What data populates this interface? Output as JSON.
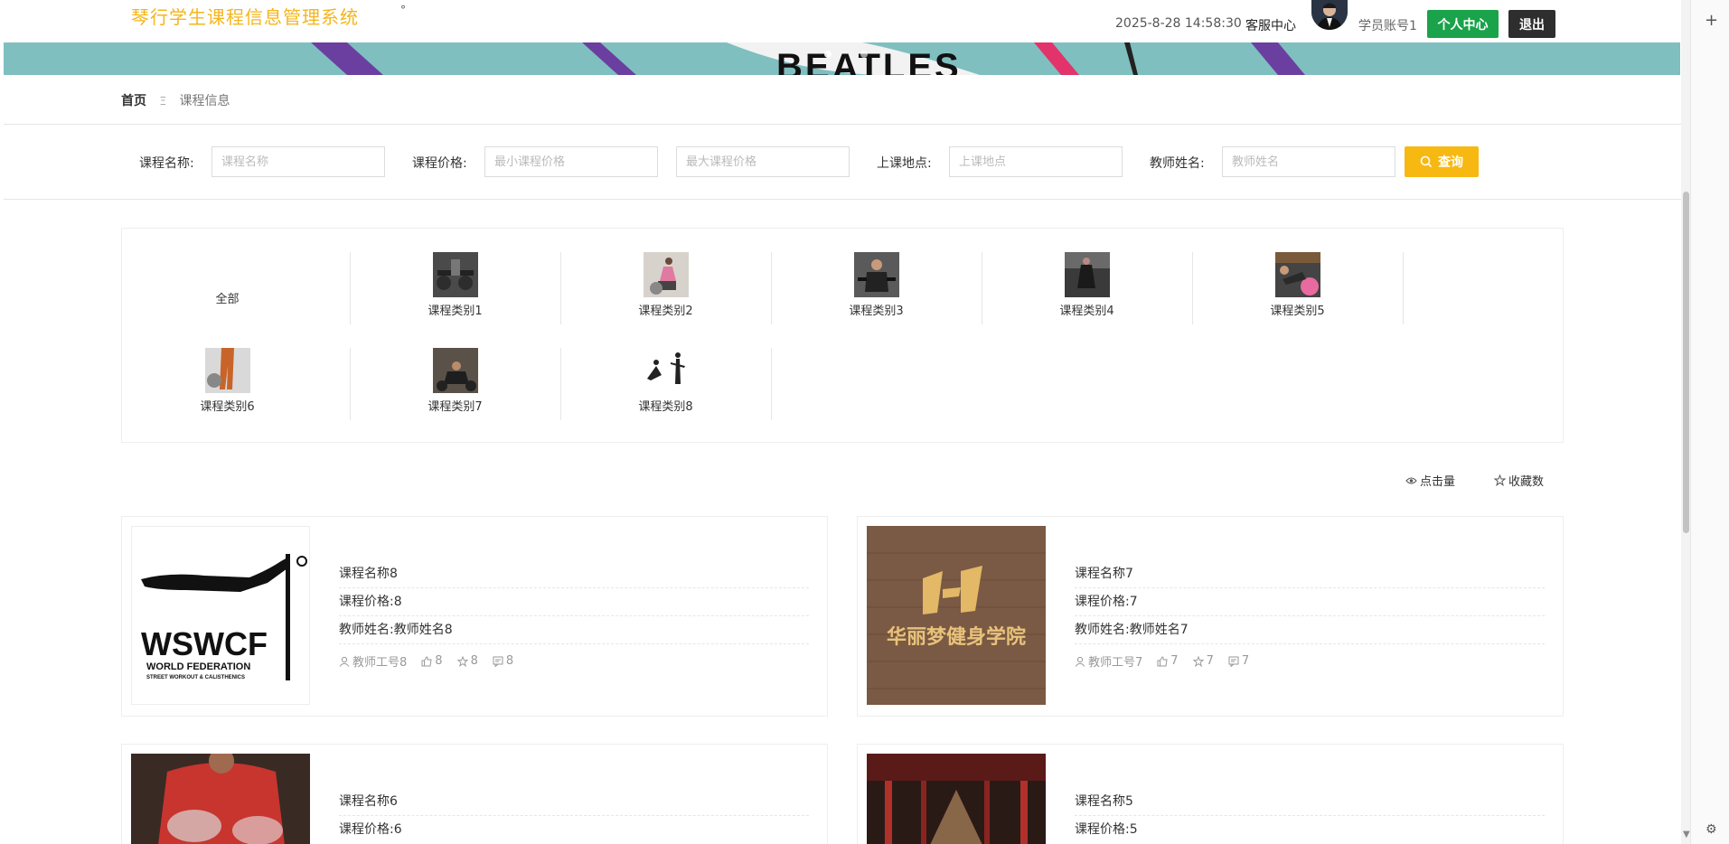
{
  "header": {
    "site_title": "琴行学生课程信息管理系统",
    "title_dot": "°",
    "datetime": "2025-8-28 14:58:30",
    "service_link": "客服中心",
    "account": "学员账号1",
    "personal_center": "个人中心",
    "logout": "退出"
  },
  "breadcrumb": {
    "home": "首页",
    "separator": "Ξ",
    "current": "课程信息"
  },
  "search": {
    "course_name_label": "课程名称:",
    "course_name_placeholder": "课程名称",
    "price_label": "课程价格:",
    "min_price_placeholder": "最小课程价格",
    "max_price_placeholder": "最大课程价格",
    "location_label": "上课地点:",
    "location_placeholder": "上课地点",
    "teacher_label": "教师姓名:",
    "teacher_placeholder": "教师姓名",
    "search_button": "查询"
  },
  "categories": [
    {
      "label": "全部"
    },
    {
      "label": "课程类别1"
    },
    {
      "label": "课程类别2"
    },
    {
      "label": "课程类别3"
    },
    {
      "label": "课程类别4"
    },
    {
      "label": "课程类别5"
    },
    {
      "label": "课程类别6"
    },
    {
      "label": "课程类别7"
    },
    {
      "label": "课程类别8"
    }
  ],
  "sort": {
    "clicks": "点击量",
    "favorites": "收藏数"
  },
  "courses": [
    {
      "name": "课程名称8",
      "price": "课程价格:8",
      "teacher": "教师姓名:教师姓名8",
      "teacher_no": "教师工号8",
      "likes": "8",
      "favorites": "8",
      "comments": "8",
      "logo_text": "WSWCF",
      "logo_sub1": "WORLD FEDERATION",
      "logo_sub2": "STREET WORKOUT & CALISTHENICS"
    },
    {
      "name": "课程名称7",
      "price": "课程价格:7",
      "teacher": "教师姓名:教师姓名7",
      "teacher_no": "教师工号7",
      "likes": "7",
      "favorites": "7",
      "comments": "7",
      "logo_text": "华丽梦健身学院"
    },
    {
      "name": "课程名称6",
      "price": "课程价格:6"
    },
    {
      "name": "课程名称5",
      "price": "课程价格:5"
    }
  ],
  "course_name_prefix": "课程名称",
  "colors": {
    "title": "#f5b51b",
    "primary_green": "#1aa34a",
    "search_yellow": "#f7b812",
    "banner": "#7fbfc0"
  }
}
